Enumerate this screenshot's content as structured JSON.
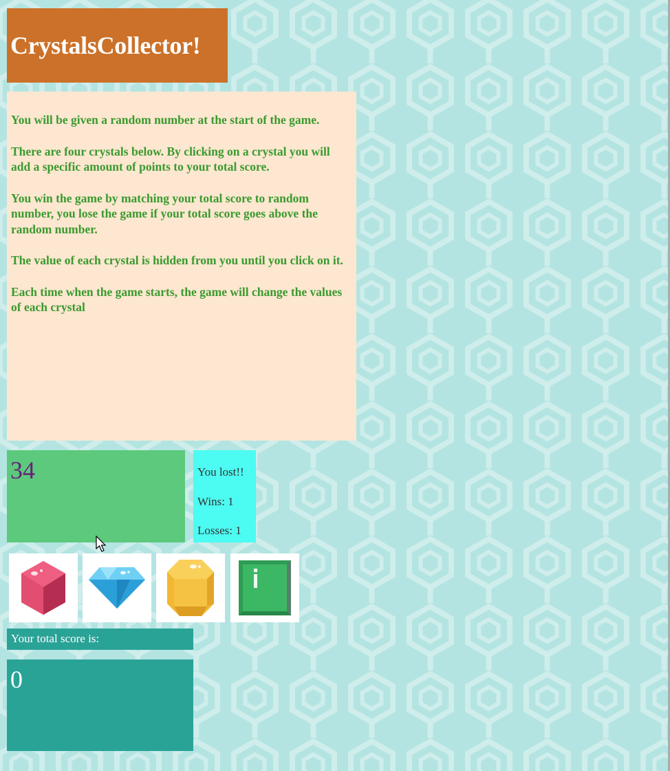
{
  "game": {
    "title": "CrystalsCollector!",
    "rules": [
      "You will be given a random number at the start of the game.",
      "There are four crystals below. By clicking on a crystal you will add a specific amount of points to your total score.",
      "You win the game by matching your total score to random number, you lose the game if your total score goes above the random number.",
      "The value of each crystal is hidden from you until you click on it.",
      "Each time when the game starts, the game will change the values of each crystal"
    ],
    "target_number": "34",
    "status": {
      "message": "You lost!!",
      "wins": "Wins: 1",
      "losses": "Losses: 1"
    },
    "crystals": [
      {
        "icon": "red-hexagon-gem-icon",
        "color": "#e24e72"
      },
      {
        "icon": "blue-diamond-gem-icon",
        "color": "#3fb5e8"
      },
      {
        "icon": "yellow-octagon-gem-icon",
        "color": "#f6c244"
      },
      {
        "icon": "green-square-gem-icon",
        "color": "#3cb865"
      }
    ],
    "score_label": "Your total score is:",
    "total_score": "0"
  },
  "colors": {
    "title_bg": "#cc7129",
    "rules_bg": "#fde7d0",
    "rules_text": "#3a9a2f",
    "target_bg": "#5cc97c",
    "target_text": "#66227a",
    "status_bg": "#4cfbf1",
    "score_bg": "#2aa397",
    "page_bg": "#b3e4e2"
  }
}
